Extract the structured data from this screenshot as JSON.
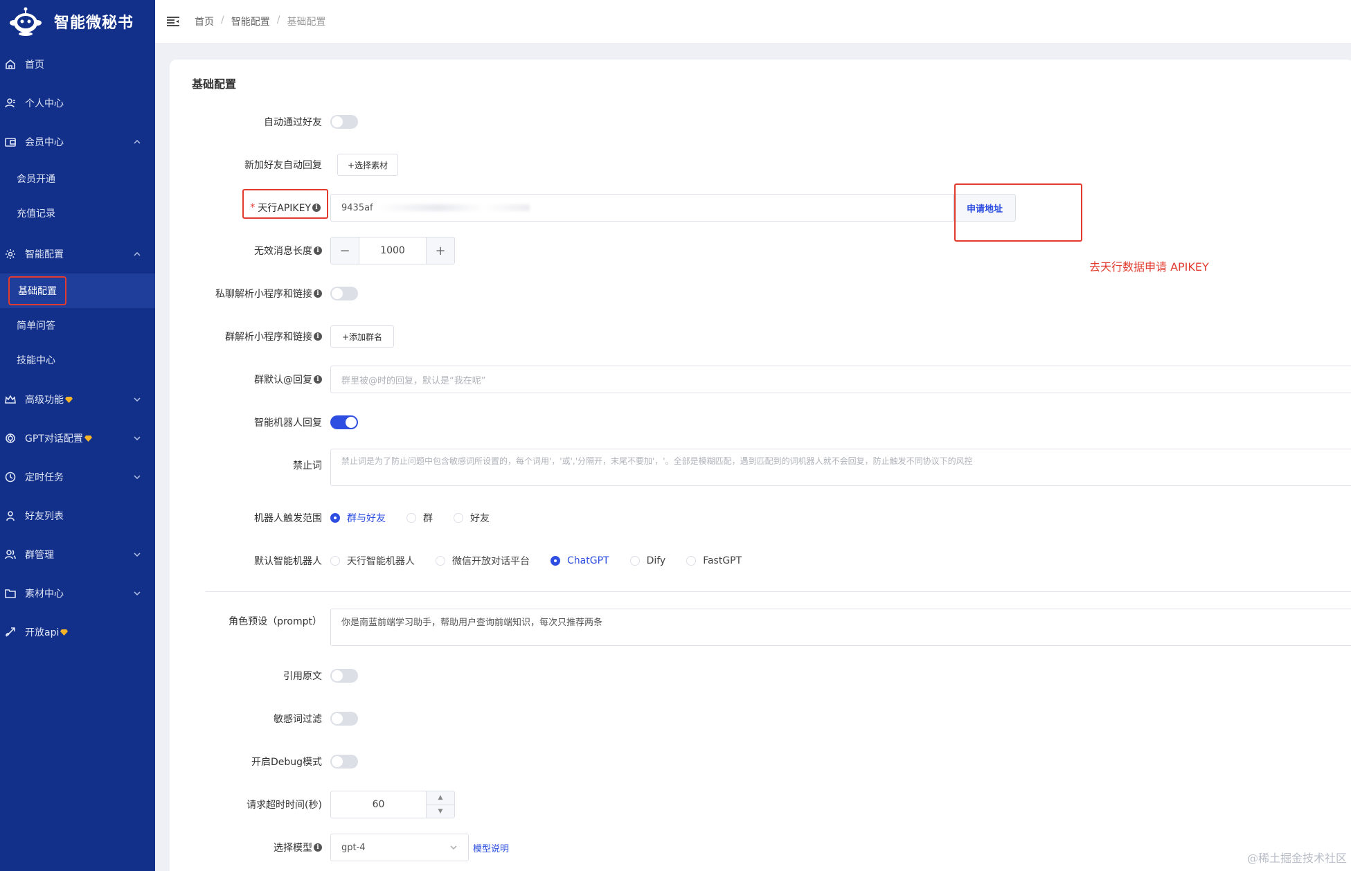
{
  "app": {
    "title": "智能微秘书"
  },
  "sidebar": {
    "items": [
      {
        "label": "首页",
        "icon": "home-icon"
      },
      {
        "label": "个人中心",
        "icon": "user-icon"
      },
      {
        "label": "会员中心",
        "icon": "wallet-icon",
        "expanded": true,
        "children": [
          {
            "label": "会员开通"
          },
          {
            "label": "充值记录"
          }
        ]
      },
      {
        "label": "智能配置",
        "icon": "gear-icon",
        "expanded": true,
        "children": [
          {
            "label": "基础配置",
            "active": true
          },
          {
            "label": "简单问答"
          },
          {
            "label": "技能中心"
          }
        ]
      },
      {
        "label": "高级功能",
        "icon": "crown-icon",
        "premium": true
      },
      {
        "label": "GPT对话配置",
        "icon": "openai-icon",
        "premium": true
      },
      {
        "label": "定时任务",
        "icon": "clock-icon"
      },
      {
        "label": "好友列表",
        "icon": "person-icon"
      },
      {
        "label": "群管理",
        "icon": "group-icon"
      },
      {
        "label": "素材中心",
        "icon": "folder-icon"
      },
      {
        "label": "开放api",
        "icon": "rocket-icon",
        "premium": true
      }
    ]
  },
  "breadcrumb": {
    "home": "首页",
    "parent": "智能配置",
    "current": "基础配置"
  },
  "card": {
    "title": "基础配置"
  },
  "form": {
    "auto_accept_friend": {
      "label": "自动通过好友",
      "on": false
    },
    "new_friend_reply": {
      "label": "新加好友自动回复",
      "button": "+选择素材"
    },
    "apikey": {
      "label": "天行APIKEY",
      "required": "*",
      "value": "9435af",
      "apply_button": "申请地址"
    },
    "invalid_msg_len": {
      "label": "无效消息长度",
      "value": "1000",
      "minus": "−",
      "plus": "+"
    },
    "private_parse": {
      "label": "私聊解析小程序和链接",
      "on": false
    },
    "group_parse": {
      "label": "群解析小程序和链接",
      "button": "+添加群名"
    },
    "group_default_reply": {
      "label": "群默认@回复",
      "placeholder": "群里被@时的回复，默认是“我在呢”"
    },
    "robot_reply": {
      "label": "智能机器人回复",
      "on": true
    },
    "forbidden_words": {
      "label": "禁止词",
      "placeholder": "禁止词是为了防止问题中包含敏感词所设置的，每个词用'，'或','分隔开，末尾不要加'，'。全部是模糊匹配，遇到匹配到的词机器人就不会回复，防止触发不同协议下的风控"
    },
    "trigger_scope": {
      "label": "机器人触发范围",
      "options": [
        "群与好友",
        "群",
        "好友"
      ],
      "selected": "群与好友"
    },
    "default_robot": {
      "label": "默认智能机器人",
      "options": [
        "天行智能机器人",
        "微信开放对话平台",
        "ChatGPT",
        "Dify",
        "FastGPT"
      ],
      "selected": "ChatGPT"
    },
    "role_prompt": {
      "label": "角色预设（prompt）",
      "value": "你是南蓝前端学习助手，帮助用户查询前端知识，每次只推荐两条"
    },
    "quote_original": {
      "label": "引用原文",
      "on": false
    },
    "sensitive_filter": {
      "label": "敏感词过滤",
      "on": false
    },
    "debug_mode": {
      "label": "开启Debug模式",
      "on": false
    },
    "request_timeout": {
      "label": "请求超时时间(秒)",
      "value": "60"
    },
    "model": {
      "label": "选择模型",
      "value": "gpt-4",
      "link": "模型说明"
    }
  },
  "annotation": {
    "text": "去天行数据申请 APIKEY",
    "color": "#e23b2e"
  },
  "watermark": "@稀土掘金技术社区",
  "colors": {
    "sidebar": "#12308a",
    "accent": "#2d4ee0",
    "annotation": "#e23b2e"
  }
}
